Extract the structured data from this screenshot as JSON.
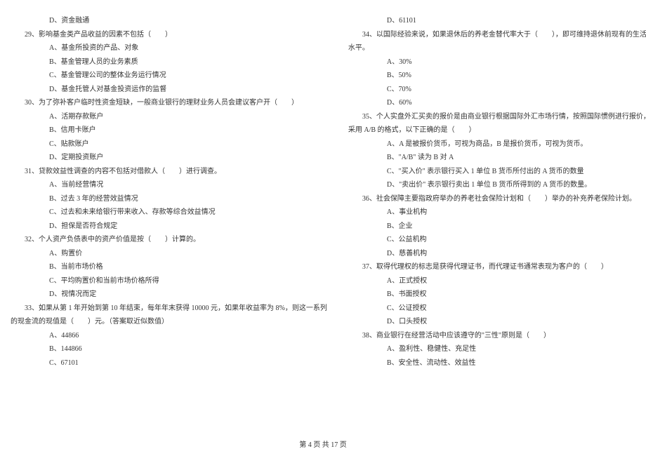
{
  "left_column": {
    "pre_option": "D、资金融通",
    "q29": {
      "stem": "29、影响基金类产品收益的因素不包括（　　）",
      "a": "A、基金所投资的产品、对象",
      "b": "B、基金管理人员的业务素质",
      "c": "C、基金管理公司的整体业务运行情况",
      "d": "D、基金托管人对基金投资运作的监督"
    },
    "q30": {
      "stem": "30、为了弥补客户临时性资金短缺，一般商业银行的理财业务人员会建议客户开（　　）",
      "a": "A、活期存款账户",
      "b": "B、信用卡账户",
      "c": "C、贴款账户",
      "d": "D、定期投资账户"
    },
    "q31": {
      "stem": "31、贷款效益性调查的内容不包括对借款人（　　）进行调查。",
      "a": "A、当前经营情况",
      "b": "B、过去 3 年的经营效益情况",
      "c": "C、过去和未来给银行带来收入、存款等综合效益情况",
      "d": "D、担保是否符合规定"
    },
    "q32": {
      "stem": "32、个人资产负债表中的资产价值是按（　　）计算的。",
      "a": "A、购置价",
      "b": "B、当前市场价格",
      "c": "C、平均购置价和当前市场价格所得",
      "d": "D、视情况而定"
    },
    "q33": {
      "stem_line1": "33、如果从第 1 年开始到第 10 年结束，每年年末获得 10000 元，如果年收益率为 8%，则这一系列",
      "stem_line2": "的现金流的现值是（　　）元。（答案取近似数值）",
      "a": "A、44866",
      "b": "B、144866",
      "c": "C、67101"
    }
  },
  "right_column": {
    "pre_option": "D、61101",
    "q34": {
      "stem_line1": "34、以国际经验来说，如果退休后的养老金替代率大于（　　），即可维持退休前现有的生活",
      "stem_line2": "水平。",
      "a": "A、30%",
      "b": "B、50%",
      "c": "C、70%",
      "d": "D、60%"
    },
    "q35": {
      "stem_line1": "35、个人实盘外汇买卖的报价是由商业银行根据国际外汇市场行情，按照国际惯例进行报价，",
      "stem_line2": "采用 A/B 的格式，以下正确的是（　　）",
      "a": "A、A 是被报价货币，可视为商品，B 是报价货币，可视为货币。",
      "b": "B、\"A/B\" 读为 B 对 A",
      "c": "C、\"买入价\" 表示银行买入 1 单位 B 货币所付出的 A 货币的数量",
      "d": "D、\"卖出价\" 表示银行卖出 1 单位 B 货币所得到的 A 货币的数量。"
    },
    "q36": {
      "stem": "36、社会保障主要指政府举办的养老社会保险计划和（　　）举办的补充养老保险计划。",
      "a": "A、事业机构",
      "b": "B、企业",
      "c": "C、公益机构",
      "d": "D、慈善机构"
    },
    "q37": {
      "stem": "37、取得代理权的标志是获得代理证书，而代理证书通常表现为客户的（　　）",
      "a": "A、正式授权",
      "b": "B、书面授权",
      "c": "C、公证授权",
      "d": "D、口头授权"
    },
    "q38": {
      "stem": "38、商业银行在经营活动中应该遵守的\"三性\"原则是（　　）",
      "a": "A、盈利性、稳健性、充足性",
      "b": "B、安全性、流动性、效益性"
    }
  },
  "footer": "第 4 页 共 17 页"
}
